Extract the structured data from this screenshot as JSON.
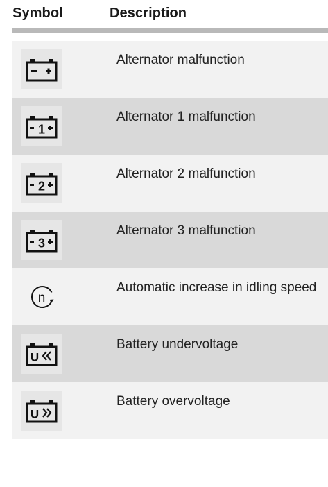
{
  "table": {
    "header": {
      "symbol": "Symbol",
      "description": "Description"
    },
    "rows": [
      {
        "icon": "battery-minus-plus-icon",
        "description": "Alternator malfunction"
      },
      {
        "icon": "battery-1-icon",
        "number": "1",
        "description": "Alternator 1 malfunction"
      },
      {
        "icon": "battery-2-icon",
        "number": "2",
        "description": "Alternator 2 malfunction"
      },
      {
        "icon": "battery-3-icon",
        "number": "3",
        "description": "Alternator 3 malfunction"
      },
      {
        "icon": "idle-speed-n-icon",
        "letter": "n",
        "description": "Automatic increase in idling speed"
      },
      {
        "icon": "battery-undervoltage-icon",
        "letter": "U",
        "description": "Battery undervoltage"
      },
      {
        "icon": "battery-overvoltage-icon",
        "letter": "U",
        "description": "Battery overvoltage"
      }
    ]
  },
  "colors": {
    "row_light": "#f2f2f2",
    "row_dark": "#d9d9d9",
    "icon": "#111111",
    "rule": "#b9b9b9"
  }
}
